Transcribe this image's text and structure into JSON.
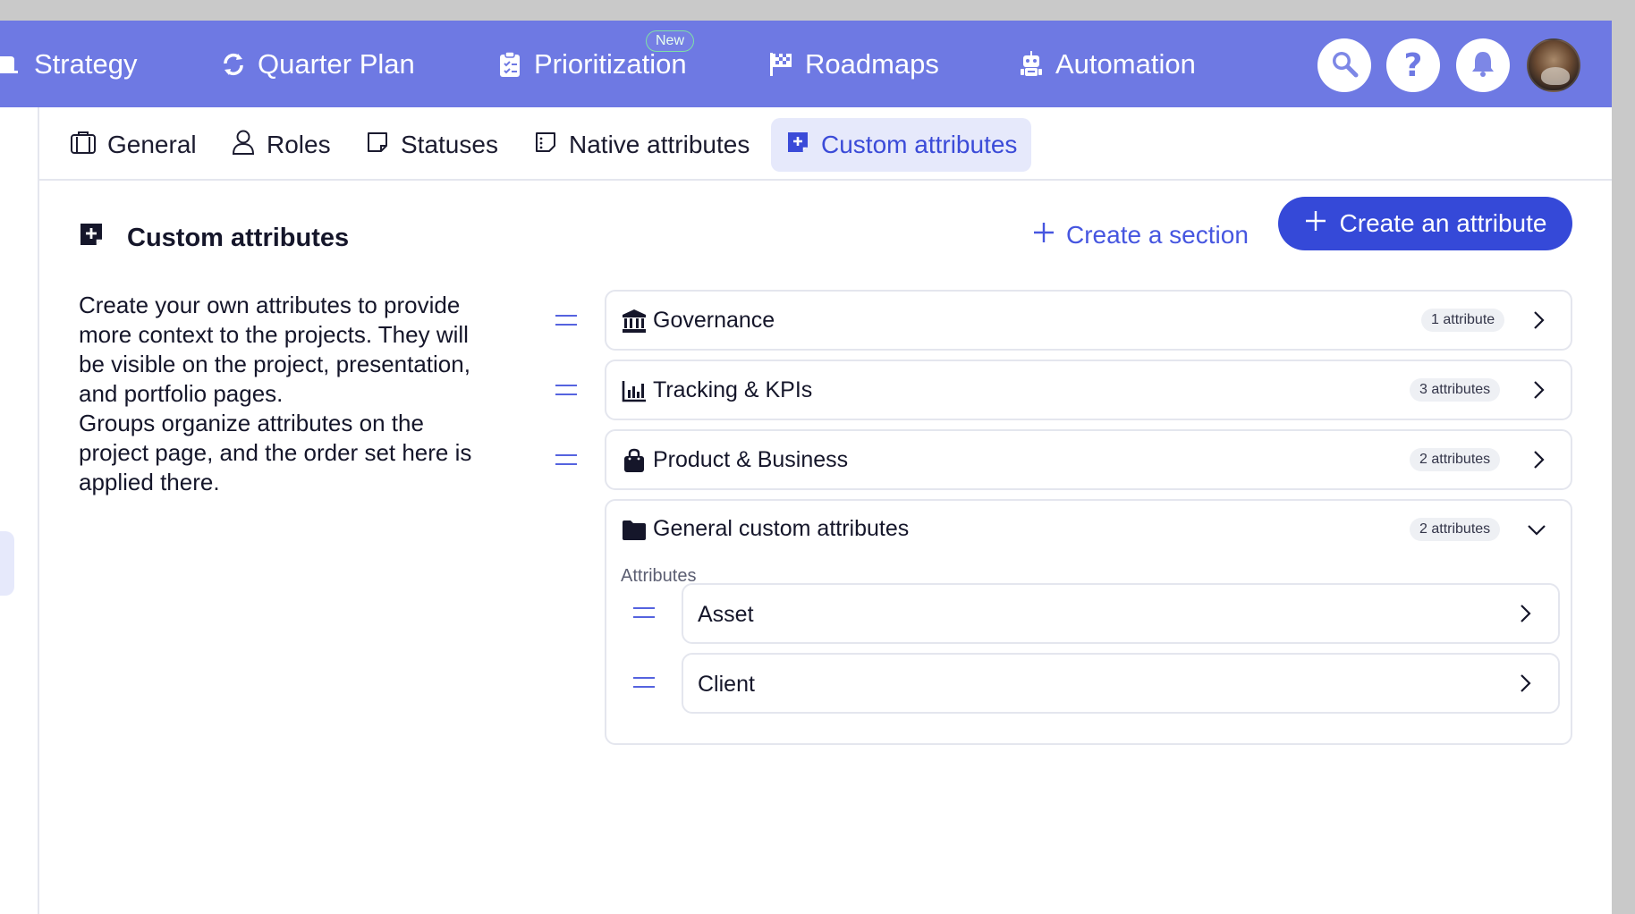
{
  "colors": {
    "nav_bg": "#6e79e3",
    "primary": "#3549d8",
    "accent_text": "#4656e0",
    "active_tab_bg": "#e6e9fb",
    "new_badge_border": "#7fe0a6"
  },
  "topnav": {
    "items": [
      {
        "label": "Strategy",
        "icon": "strategy-icon"
      },
      {
        "label": "Quarter Plan",
        "icon": "refresh-cycle-icon"
      },
      {
        "label": "Prioritization",
        "icon": "clipboard-check-icon",
        "badge": "New"
      },
      {
        "label": "Roadmaps",
        "icon": "checkered-flag-icon"
      },
      {
        "label": "Automation",
        "icon": "robot-icon"
      }
    ],
    "actions": [
      {
        "name": "search",
        "icon": "search-icon",
        "label": ""
      },
      {
        "name": "help",
        "icon": "question-mark-icon",
        "label": "?"
      },
      {
        "name": "notifications",
        "icon": "bell-icon",
        "label": ""
      }
    ]
  },
  "subtabs": [
    {
      "label": "General",
      "icon": "briefcase-icon",
      "active": false
    },
    {
      "label": "Roles",
      "icon": "user-icon",
      "active": false
    },
    {
      "label": "Statuses",
      "icon": "sticky-note-icon",
      "active": false
    },
    {
      "label": "Native attributes",
      "icon": "dashed-note-icon",
      "active": false
    },
    {
      "label": "Custom attributes",
      "icon": "note-plus-icon",
      "active": true
    }
  ],
  "page": {
    "title": "Custom attributes",
    "create_section_label": "Create a section",
    "create_attribute_label": "Create an attribute",
    "description_lines": [
      "Create your own attributes to provide more context to the projects. They will be visible on the project, presentation, and portfolio pages.",
      "Groups organize attributes on the project page, and the order set here is applied there."
    ]
  },
  "sections": [
    {
      "name": "Governance",
      "icon": "bank-icon",
      "count": "1 attribute",
      "expanded": false
    },
    {
      "name": "Tracking & KPIs",
      "icon": "bar-chart-icon",
      "count": "3 attributes",
      "expanded": false
    },
    {
      "name": "Product & Business",
      "icon": "shopping-bag-icon",
      "count": "2 attributes",
      "expanded": false
    },
    {
      "name": "General custom attributes",
      "icon": "folder-icon",
      "count": "2 attributes",
      "expanded": true,
      "attributes_label": "Attributes",
      "attributes": [
        {
          "name": "Asset"
        },
        {
          "name": "Client"
        }
      ]
    }
  ]
}
